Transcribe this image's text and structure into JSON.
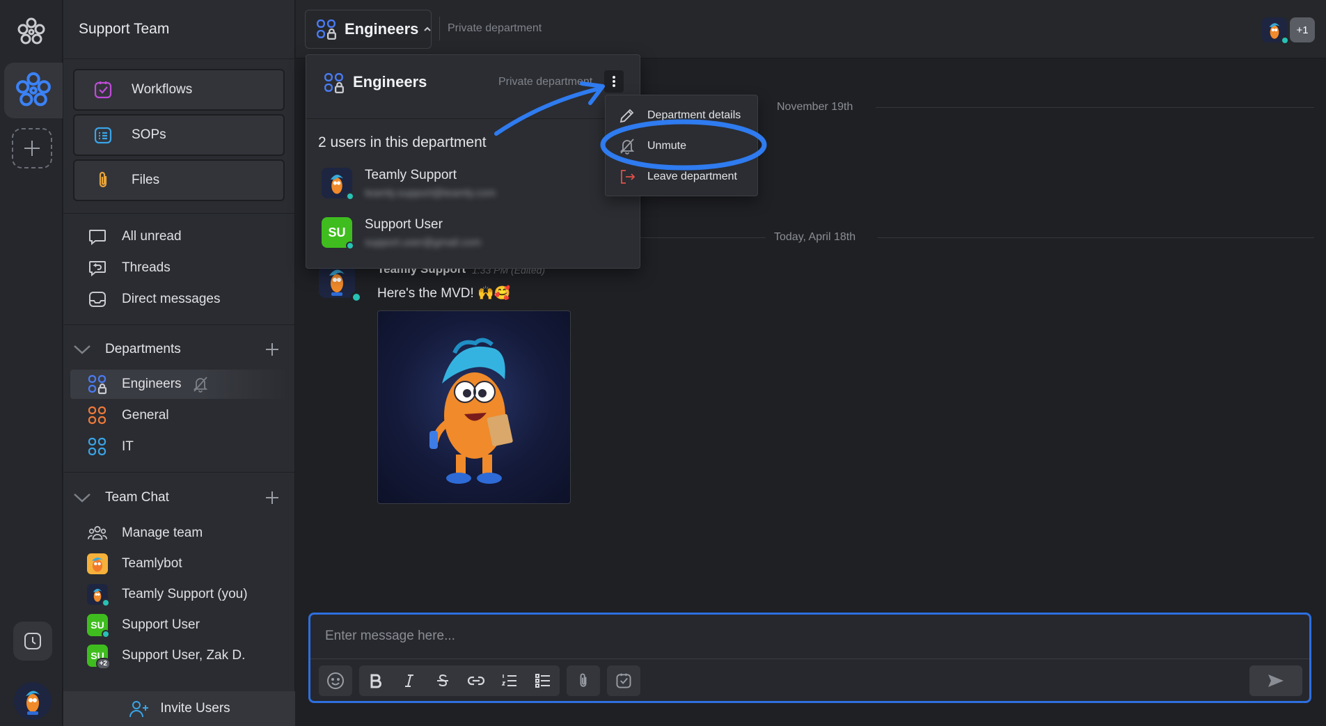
{
  "workspace": {
    "name": "Support Team"
  },
  "sidebar": {
    "tiles": [
      {
        "label": "Workflows",
        "icon": "workflows-icon"
      },
      {
        "label": "SOPs",
        "icon": "sops-icon"
      },
      {
        "label": "Files",
        "icon": "paperclip-icon"
      }
    ],
    "nav": [
      {
        "label": "All unread",
        "icon": "chat-bubble-icon"
      },
      {
        "label": "Threads",
        "icon": "threads-icon"
      },
      {
        "label": "Direct messages",
        "icon": "inbox-icon"
      }
    ],
    "departments": {
      "title": "Departments",
      "items": [
        {
          "label": "Engineers",
          "icon": "private-department-icon",
          "muted": true,
          "active": true,
          "color": "#4a7cf5"
        },
        {
          "label": "General",
          "icon": "department-icon",
          "color": "#f07a3a"
        },
        {
          "label": "IT",
          "icon": "department-icon",
          "color": "#3aa5e8"
        }
      ]
    },
    "team_chat": {
      "title": "Team Chat",
      "items": [
        {
          "label": "Manage team",
          "icon": "team-icon"
        },
        {
          "label": "Teamlybot",
          "avatar": "teamlybot"
        },
        {
          "label": "Teamly Support (you)",
          "avatar": "teamly-support",
          "online": true
        },
        {
          "label": "Support User",
          "avatar_initials": "SU",
          "online": true
        },
        {
          "label": "Support User, Zak D.",
          "avatar_initials": "SU",
          "badge": "+2"
        }
      ]
    },
    "invite_label": "Invite Users"
  },
  "header": {
    "department": "Engineers",
    "privacy": "Private department",
    "extra_members": "+1"
  },
  "messages": {
    "date_dividers": [
      "November 19th",
      "Today, April 18th"
    ],
    "items": [
      {
        "author": "Teamly Support",
        "time": "1:33 PM (Edited)",
        "text": "Here's the MVD! 🙌🥰",
        "has_image": true
      }
    ]
  },
  "composer": {
    "placeholder": "Enter message here...",
    "tools": [
      "emoji-icon",
      "bold-icon",
      "italic-icon",
      "strikethrough-icon",
      "link-icon",
      "numbered-list-icon",
      "bullet-list-icon",
      "attach-icon",
      "task-icon"
    ]
  },
  "department_popover": {
    "title": "Engineers",
    "privacy": "Private department",
    "count_label": "2 users in this department",
    "users": [
      {
        "name": "Teamly Support",
        "email": "teamly.support@teamly.com"
      },
      {
        "name": "Support User",
        "email": "support.user@gmail.com",
        "initials": "SU"
      }
    ]
  },
  "context_menu": {
    "items": [
      {
        "label": "Department details",
        "icon": "pencil-icon"
      },
      {
        "label": "Unmute",
        "icon": "bell-off-icon",
        "highlighted": true
      },
      {
        "label": "Leave department",
        "icon": "leave-icon",
        "danger": true
      }
    ]
  },
  "colors": {
    "accent": "#2d6fe0",
    "annotation": "#2f7bf0",
    "online": "#27c2b5",
    "su_green": "#3fbd1f"
  }
}
